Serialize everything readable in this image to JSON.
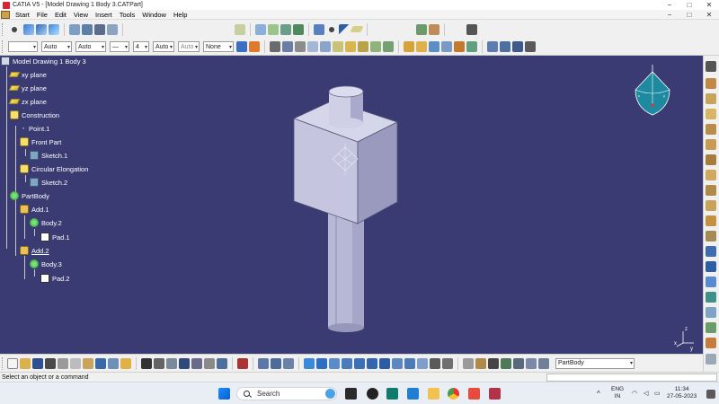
{
  "window": {
    "title": "CATIA V5 - [Model Drawing 1 Body 3.CATPart]",
    "buttons": [
      "−",
      "□",
      "✕"
    ]
  },
  "menu": {
    "items": [
      "Start",
      "File",
      "Edit",
      "View",
      "Insert",
      "Tools",
      "Window",
      "Help"
    ],
    "doc_buttons": [
      "−",
      "□",
      "✕"
    ]
  },
  "toolbar2": {
    "combos": [
      "",
      "Auto",
      "Auto",
      "—",
      "4",
      "Auto",
      "Auto",
      "None"
    ]
  },
  "tree": {
    "root": "Model Drawing 1 Body 3",
    "nodes": [
      {
        "label": "xy plane",
        "icon": "plane-icon"
      },
      {
        "label": "yz plane",
        "icon": "plane-icon"
      },
      {
        "label": "zx plane",
        "icon": "plane-icon"
      },
      {
        "label": "Construction",
        "icon": "geometrical-set-icon"
      },
      {
        "label": "Point.1",
        "icon": "point-icon"
      },
      {
        "label": "Front Part",
        "icon": "geometrical-set-icon"
      },
      {
        "label": "Sketch.1",
        "icon": "sketch-icon"
      },
      {
        "label": "Circular Elongation",
        "icon": "geometrical-set-icon"
      },
      {
        "label": "Sketch.2",
        "icon": "sketch-icon"
      },
      {
        "label": "PartBody",
        "icon": "body-icon"
      },
      {
        "label": "Add.1",
        "icon": "add-operation-icon"
      },
      {
        "label": "Body.2",
        "icon": "body-icon"
      },
      {
        "label": "Pad.1",
        "icon": "pad-icon"
      },
      {
        "label": "Add.2",
        "icon": "add-operation-icon"
      },
      {
        "label": "Body.3",
        "icon": "body-icon"
      },
      {
        "label": "Pad.2",
        "icon": "pad-icon"
      }
    ]
  },
  "bottom": {
    "current_body": "PartBody"
  },
  "status": {
    "message": "Select an object or a command"
  },
  "taskbar": {
    "search_placeholder": "Search",
    "language": "ENG",
    "region": "IN",
    "time": "11:34",
    "date": "27-05-2023"
  },
  "colors": {
    "viewport_bg": "#3a3b72",
    "part_face_light": "#d6d6ea",
    "part_face_mid": "#b9b9d6",
    "part_face_dark": "#8b8bb0"
  },
  "compass_axes": [
    "x",
    "y",
    "z"
  ]
}
